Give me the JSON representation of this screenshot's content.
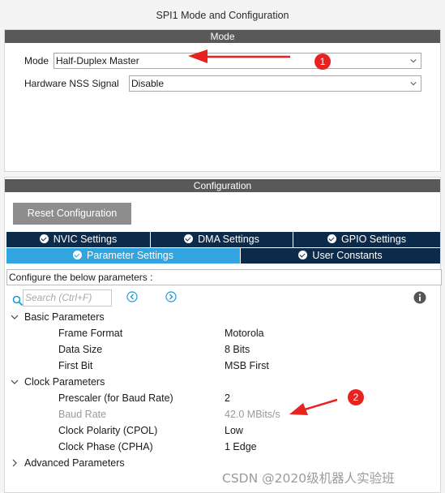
{
  "window": {
    "title": "SPI1 Mode and Configuration"
  },
  "mode_panel": {
    "header": "Mode",
    "mode": {
      "label": "Mode",
      "value": "Half-Duplex Master"
    },
    "nss": {
      "label": "Hardware NSS Signal",
      "value": "Disable"
    }
  },
  "config_panel": {
    "header": "Configuration",
    "reset_button": "Reset Configuration",
    "tabs_row1": [
      "NVIC Settings",
      "DMA Settings",
      "GPIO Settings"
    ],
    "tabs_row2": [
      "Parameter Settings",
      "User Constants"
    ],
    "active_tab": "Parameter Settings",
    "configure_text": "Configure the below parameters :",
    "search": {
      "placeholder": "Search (Ctrl+F)"
    },
    "groups": [
      {
        "name": "Basic Parameters",
        "expanded": true,
        "params": [
          {
            "name": "Frame Format",
            "value": "Motorola",
            "disabled": false
          },
          {
            "name": "Data Size",
            "value": "8 Bits",
            "disabled": false
          },
          {
            "name": "First Bit",
            "value": "MSB First",
            "disabled": false
          }
        ]
      },
      {
        "name": "Clock Parameters",
        "expanded": true,
        "params": [
          {
            "name": "Prescaler (for Baud Rate)",
            "value": "2",
            "disabled": false
          },
          {
            "name": "Baud Rate",
            "value": "42.0 MBits/s",
            "disabled": true
          },
          {
            "name": "Clock Polarity (CPOL)",
            "value": "Low",
            "disabled": false
          },
          {
            "name": "Clock Phase (CPHA)",
            "value": "1 Edge",
            "disabled": false
          }
        ]
      },
      {
        "name": "Advanced Parameters",
        "expanded": false,
        "params": []
      }
    ]
  },
  "annotations": {
    "marker1": "1",
    "marker2": "2",
    "arrow_color": "#e8231f"
  },
  "watermark": "CSDN @2020级机器人实验班",
  "colors": {
    "header_bg": "#595959",
    "tab_dark": "#0c2b4b",
    "tab_active": "#32a4e0",
    "reset_btn": "#8d8d8d",
    "icon_blue": "#1a9ad6"
  }
}
